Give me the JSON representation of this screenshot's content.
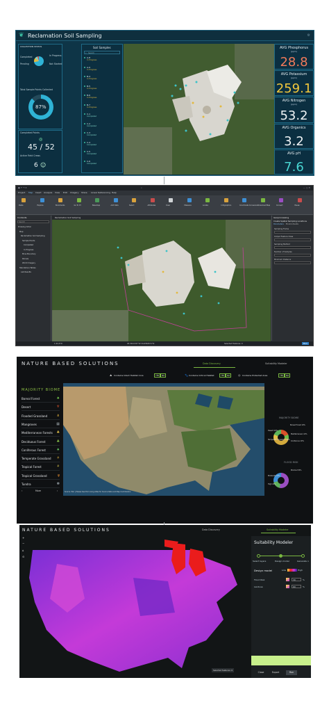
{
  "dashboard": {
    "title": "Reclamation Soil Sampling",
    "collection_status": {
      "heading": "COLLECTION STATUS",
      "pie_labels": [
        "Completed",
        "In Progress",
        "Pending",
        "Not Started"
      ],
      "total_label": "Total Sample Points Collected",
      "percent": "87%",
      "percent_value": 0.87
    },
    "completed_header": "Completed Points",
    "completed_count": "45 / 52",
    "team_label": "Active Field Crews",
    "team_count": "6",
    "samples": {
      "heading": "Soil Samples",
      "search_placeholder": "Search",
      "items": [
        {
          "name": "A-8",
          "status": "In Progress"
        },
        {
          "name": "A-9",
          "status": "In Progress"
        },
        {
          "name": "B-4",
          "status": "In Progress"
        },
        {
          "name": "B-5",
          "status": "In Progress"
        },
        {
          "name": "B-6",
          "status": "In Progress"
        },
        {
          "name": "B-7",
          "status": "In Progress"
        },
        {
          "name": "C-1",
          "status": "Completed"
        },
        {
          "name": "C-2",
          "status": "Completed"
        },
        {
          "name": "C-3",
          "status": "Completed"
        },
        {
          "name": "C-4",
          "status": "Completed"
        },
        {
          "name": "C-5",
          "status": "Completed"
        },
        {
          "name": "C-6",
          "status": "Completed"
        }
      ]
    },
    "stats": [
      {
        "title": "AVG Phosphorus",
        "unit": "(ppm)",
        "value": "28.8",
        "color": "#f07a5a"
      },
      {
        "title": "AVG Potassium",
        "unit": "(ppm)",
        "value": "259.1",
        "color": "#f2c83c"
      },
      {
        "title": "AVG Nitrogen",
        "unit": "(ppm)",
        "value": "53.2",
        "color": "#eef3f5"
      },
      {
        "title": "AVG Organics",
        "unit": "",
        "value": "3.2",
        "color": "#eef3f5"
      },
      {
        "title": "AVG pH",
        "unit": "",
        "value": "7.6",
        "color": "#49d6d2"
      }
    ]
  },
  "arcgis": {
    "tabs": [
      "Project",
      "Map",
      "Insert",
      "Analysis",
      "View",
      "Edit",
      "Imagery",
      "Share",
      "Linear Referencing",
      "Help"
    ],
    "ribbon_buttons": [
      "Paste",
      "Explore",
      "Bookmarks",
      "Go To XY",
      "Basemap",
      "Add Data",
      "Select",
      "Attributes",
      "Clear",
      "Measure",
      "Locate",
      "Infographics",
      "Coordinate Conversion",
      "Download Map",
      "Convert",
      "Pause"
    ],
    "contents_title": "Contents",
    "search_placeholder": "Search",
    "toc": [
      "Drawing Order",
      "Map",
      "Reclamation Soil Sampling",
      "Sample Points",
      "Completed",
      "In Progress",
      "Mine Boundary",
      "Parcels",
      "World Imagery",
      "Standalone Tables",
      "Lab Results"
    ],
    "map_tab": "Reclamation Soil Sampling",
    "scale": "1:44,379",
    "coords": "93.3011337°W 34.6584571°N",
    "selected": "Selected Features: 0",
    "gp_title": "Geoprocessing",
    "gp_tool": "Create Spatial Sampling Locations",
    "gp_tabs": [
      "Parameters",
      "Environments"
    ],
    "gp_fields": [
      "Sampling Frame",
      "Output Feature Class",
      "Sampling Method",
      "Number of Samples",
      "Minimum Distance"
    ],
    "run": "Run"
  },
  "nbs": {
    "title": "NATURE BASED SOLUTIONS",
    "tabs": [
      "Data Discovery",
      "Suitability Modeler"
    ],
    "filters": [
      {
        "label": "Contains Intact Habitat Core",
        "yes": "YES",
        "no": "NO"
      },
      {
        "label": "Contains Critical Habitat",
        "yes": "YES",
        "no": "NO"
      },
      {
        "label": "Contains Protected Area",
        "yes": "YES",
        "no": "NO"
      }
    ],
    "biome_heading": "MAJORITY BIOME",
    "biomes": [
      {
        "name": "Boreal Forest",
        "icon": "pine-tree-icon",
        "color": "#6fbf4a"
      },
      {
        "name": "Desert",
        "icon": "cactus-icon",
        "color": "#d9522a"
      },
      {
        "name": "Flooded Grassland",
        "icon": "grass-icon",
        "color": "#e3b23c"
      },
      {
        "name": "Mangroves",
        "icon": "mangrove-icon",
        "color": "#9aa3a8"
      },
      {
        "name": "Mediterranean Forests",
        "icon": "shrub-icon",
        "color": "#e0c04a"
      },
      {
        "name": "Deciduous Forest",
        "icon": "leaf-tree-icon",
        "color": "#8bc34a"
      },
      {
        "name": "Coniferous Forest",
        "icon": "conifer-icon",
        "color": "#5ab45a"
      },
      {
        "name": "Temperate Grassland",
        "icon": "wheat-icon",
        "color": "#d2a93c"
      },
      {
        "name": "Tropical Forest",
        "icon": "palm-tree-icon",
        "color": "#d7c14a"
      },
      {
        "name": "Tropical Grassland",
        "icon": "savanna-icon",
        "color": "#e08a2e"
      },
      {
        "name": "Tundra",
        "icon": "snowflake-icon",
        "color": "#c7d4dc"
      }
    ],
    "more_label": "More",
    "right_heading_1": "MAJORITY BIOME",
    "right_heading_2": "FLOOD RISK",
    "donut1_labels": [
      "Desert 19%",
      "Boreal Forest 10%",
      "Temperate Grassland 40%",
      "Mediterranean 12%",
      "Coniferous 19%"
    ],
    "donut2_labels": [
      "Minimal 53%",
      "Moderate 18%",
      "High 29%"
    ],
    "attribution": "Source: Esri | Please See Esri Living Atlas for Source Data and Map Contributors"
  },
  "modeler": {
    "title": "NATURE BASED SOLUTIONS",
    "tabs": [
      "Data Discovery",
      "Suitability Modeler"
    ],
    "panel_title": "Suitability Modeler",
    "steps": [
      "Select layers",
      "Design model",
      "Generate n"
    ],
    "design_label": "Design model",
    "low": "Low",
    "high": "High",
    "rows": [
      {
        "label": "Flood Risk",
        "value": "30",
        "unit": "%"
      },
      {
        "label": "Landuse",
        "value": "60",
        "unit": "%"
      }
    ],
    "selected": "Selected features: 0",
    "buttons": [
      "Close",
      "Export",
      "Run"
    ]
  }
}
